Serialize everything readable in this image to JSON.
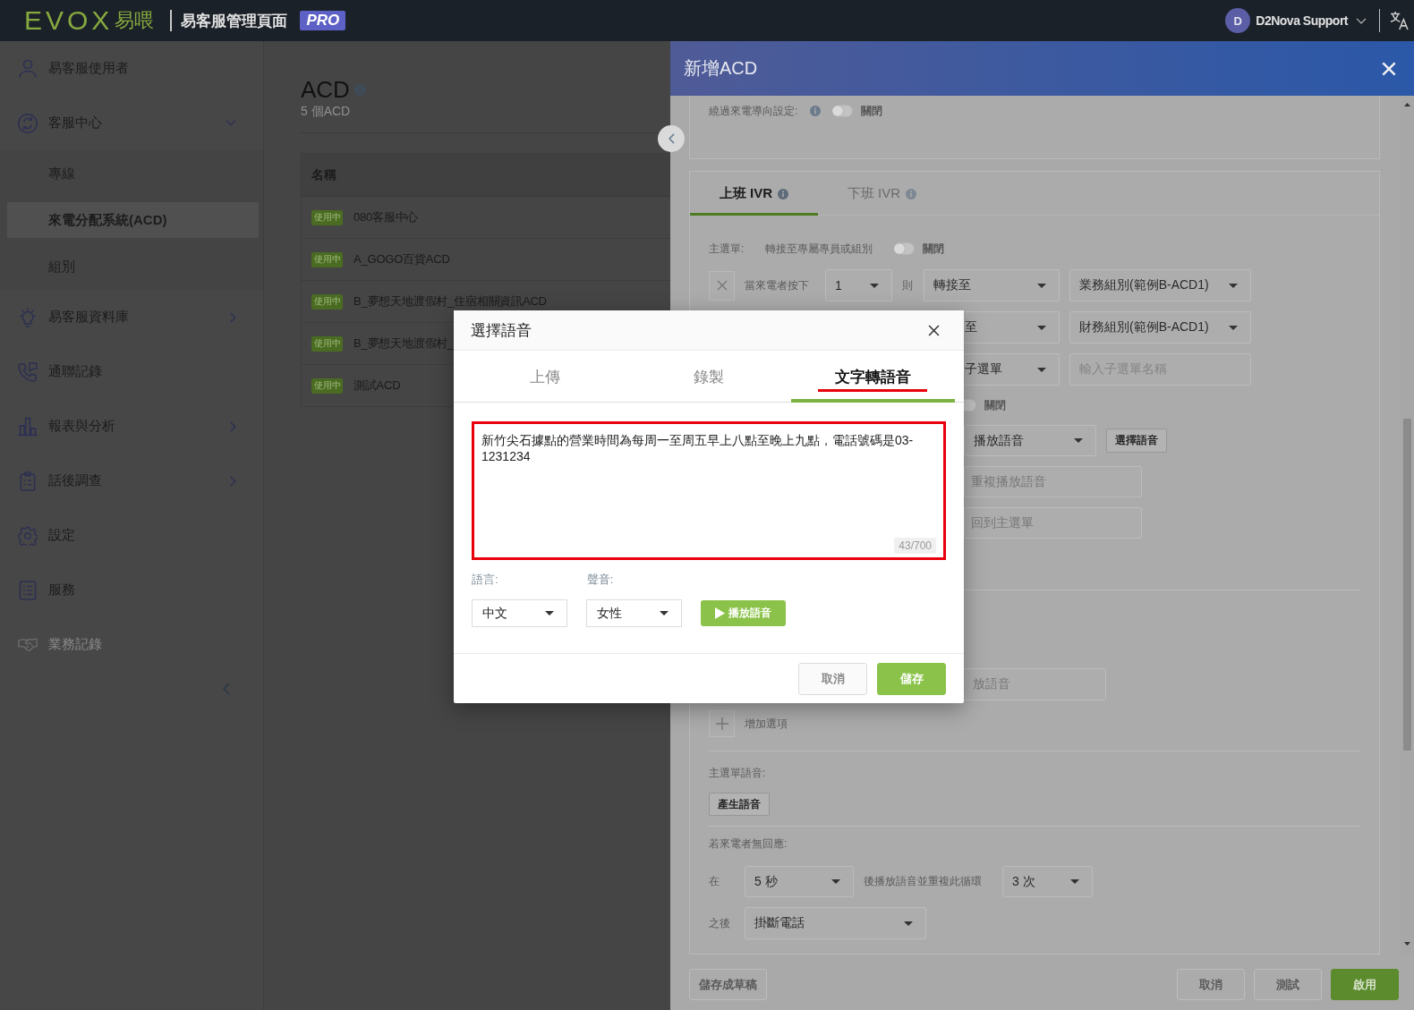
{
  "topbar": {
    "logo": "EVOX",
    "logo_chinese": "易喂",
    "app_title": "易客服管理頁面",
    "edition_badge": "PRO",
    "user": {
      "initial": "D",
      "name": "D2Nova Support"
    }
  },
  "sidebar": {
    "items": [
      {
        "label": "易客服使用者",
        "selected": false,
        "disabled": false
      },
      {
        "label": "客服中心",
        "selected": false,
        "disabled": false,
        "expanded": true,
        "children": [
          {
            "label": "專線",
            "selected": false
          },
          {
            "label": "來電分配系統(ACD)",
            "selected": true
          },
          {
            "label": "組別",
            "selected": false
          }
        ]
      },
      {
        "label": "易客服資料庫",
        "selected": false,
        "disabled": false,
        "expanded": false
      },
      {
        "label": "通聯記錄",
        "selected": false,
        "disabled": false
      },
      {
        "label": "報表與分析",
        "selected": false,
        "disabled": false,
        "expanded": false
      },
      {
        "label": "話後調查",
        "selected": false,
        "disabled": false,
        "expanded": false
      },
      {
        "label": "設定",
        "selected": false,
        "disabled": false
      },
      {
        "label": "服務",
        "selected": false,
        "disabled": false
      },
      {
        "label": "業務記錄",
        "selected": false,
        "disabled": true
      }
    ]
  },
  "acd_page": {
    "title": "ACD",
    "subtitle": "5 個ACD",
    "table": {
      "columns": [
        "名稱"
      ],
      "rows": [
        {
          "status": "使用中",
          "name": "080客服中心"
        },
        {
          "status": "使用中",
          "name": "A_GOGO百貨ACD"
        },
        {
          "status": "使用中",
          "name": "B_夢想天地渡假村_住宿相關資訊ACD"
        },
        {
          "status": "使用中",
          "name": "B_夢想天地渡假村_"
        },
        {
          "status": "使用中",
          "name": "測試ACD"
        }
      ]
    }
  },
  "drawer": {
    "title": "新增ACD",
    "bypass": {
      "label": "繞過來電導向設定:",
      "on": false,
      "state_text": "關閉"
    },
    "ivr_tabs": [
      {
        "label": "上班 IVR",
        "selected": true
      },
      {
        "label": "下班 IVR",
        "selected": false
      }
    ],
    "main_menu": {
      "label": "主選單:",
      "toggle_label": "轉接至專屬專員或組別",
      "on": false,
      "state_text": "關閉"
    },
    "menu_rows": [
      {
        "kind": "option",
        "prompt": "當來電者按下",
        "key": "1",
        "then": "則",
        "action": "轉接至",
        "target": "業務組別(範例B-ACD1)"
      },
      {
        "kind": "partial-select",
        "action": "至",
        "target": "財務組別(範例B-ACD1)"
      },
      {
        "kind": "partial-input",
        "action": "子選單",
        "placeholder": "輸入子選單名稱"
      },
      {
        "kind": "partial-toggle",
        "on": false,
        "state_text": "關閉"
      },
      {
        "kind": "voice",
        "action": "播放語音",
        "button": "選擇語音"
      },
      {
        "kind": "box",
        "text": "重複播放語音"
      },
      {
        "kind": "box",
        "text": "回到主選單"
      },
      {
        "kind": "divider"
      },
      {
        "kind": "partial-box",
        "text": "放語音"
      }
    ],
    "add_option": "增加選項",
    "menu_voice": {
      "label": "主選單語音:",
      "button": "產生語音"
    },
    "no_response": {
      "label": "若來電者無回應:",
      "wait_prefix": "在",
      "wait": "5 秒",
      "repeat_label": "後播放語音並重複此循環",
      "repeat": "3 次",
      "after_label": "之後",
      "after": "掛斷電話"
    },
    "footer": {
      "draft_button": "儲存成草稿",
      "buttons": [
        {
          "label": "取消",
          "kind": "secondary"
        },
        {
          "label": "測試",
          "kind": "secondary"
        },
        {
          "label": "啟用",
          "kind": "primary"
        }
      ]
    }
  },
  "voice_dialog": {
    "title": "選擇語音",
    "tabs": [
      {
        "label": "上傳",
        "selected": false,
        "highlighted": false
      },
      {
        "label": "錄製",
        "selected": false,
        "highlighted": false
      },
      {
        "label": "文字轉語音",
        "selected": true,
        "highlighted": true
      }
    ],
    "text_field": {
      "value": "新竹尖石據點的營業時間為每周一至周五早上八點至晚上九點，電話號碼是03-1231234",
      "counter": "43/700",
      "highlighted": true
    },
    "language": {
      "label": "語言:",
      "value": "中文"
    },
    "voice": {
      "label": "聲音:",
      "value": "女性"
    },
    "play_button": "播放語音",
    "buttons": [
      {
        "label": "取消",
        "kind": "secondary"
      },
      {
        "label": "儲存",
        "kind": "primary"
      }
    ]
  }
}
